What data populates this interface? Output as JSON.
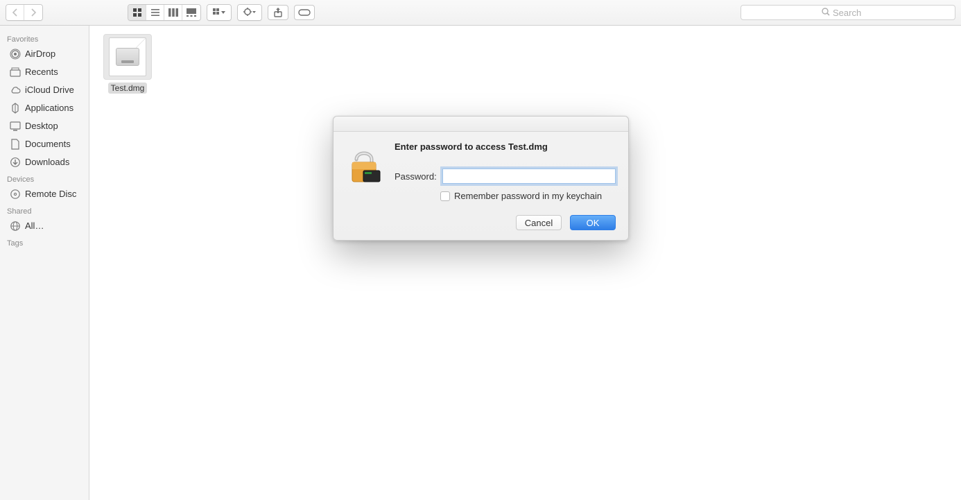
{
  "toolbar": {
    "search_placeholder": "Search"
  },
  "sidebar": {
    "sections": {
      "favorites": {
        "title": "Favorites",
        "items": [
          {
            "label": "AirDrop"
          },
          {
            "label": "Recents"
          },
          {
            "label": "iCloud Drive"
          },
          {
            "label": "Applications"
          },
          {
            "label": "Desktop"
          },
          {
            "label": "Documents"
          },
          {
            "label": "Downloads"
          }
        ]
      },
      "devices": {
        "title": "Devices",
        "items": [
          {
            "label": "Remote Disc"
          }
        ]
      },
      "shared": {
        "title": "Shared",
        "items": [
          {
            "label": "All…"
          }
        ]
      },
      "tags": {
        "title": "Tags",
        "items": []
      }
    }
  },
  "content": {
    "files": [
      {
        "name": "Test.dmg"
      }
    ]
  },
  "dialog": {
    "heading": "Enter password to access Test.dmg",
    "password_label": "Password:",
    "remember_label": "Remember password in my keychain",
    "cancel": "Cancel",
    "ok": "OK"
  }
}
